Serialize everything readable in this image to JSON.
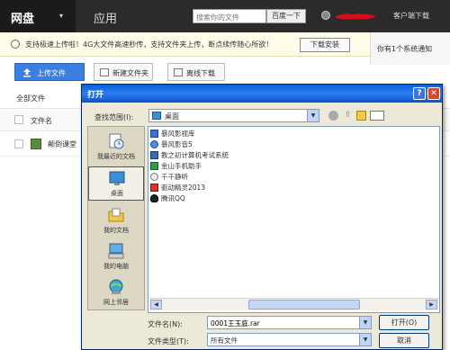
{
  "nav": {
    "wangpan": "网盘",
    "yingyong": "应用",
    "search_placeholder": "搜索你的文件",
    "search_button": "百度一下",
    "client_download": "客户端下载"
  },
  "notice": {
    "text": "支持极速上传啦！4G大文件高速秒传，支持文件夹上传，断点续传随心所欲！",
    "button": "下载安装",
    "sys_notify": "你有1个系统通知"
  },
  "toolbar": {
    "upload": "上传文件",
    "new_folder": "新建文件夹",
    "offline": "离线下载"
  },
  "list": {
    "all_files": "全部文件",
    "col_name": "文件名",
    "row1_name": "颠倒课堂"
  },
  "dialog": {
    "title": "打开",
    "lookin_label": "查找范围(I):",
    "lookin_value": "桌面",
    "places": [
      {
        "label": "我最近的文档"
      },
      {
        "label": "桌面"
      },
      {
        "label": "我的文档"
      },
      {
        "label": "我的电脑"
      },
      {
        "label": "网上邻居"
      }
    ],
    "files": [
      {
        "name": "暴风影视库"
      },
      {
        "name": "暴风影音5"
      },
      {
        "name": "教之初计算机考试系统"
      },
      {
        "name": "金山手机助手"
      },
      {
        "name": "千千静听"
      },
      {
        "name": "驱动精灵2013"
      },
      {
        "name": "腾讯QQ"
      }
    ],
    "filename_label": "文件名(N):",
    "filename_value": "0001王玉庭.rar",
    "filetype_label": "文件类型(T):",
    "filetype_value": "所有文件",
    "open_button": "打开(O)",
    "cancel_button": "取消"
  },
  "colors": {
    "topbar": "#2b2b2b",
    "upload_blue": "#3b7fe0",
    "xp_title": "#0a5fd8",
    "xp_face": "#ece9d8"
  }
}
